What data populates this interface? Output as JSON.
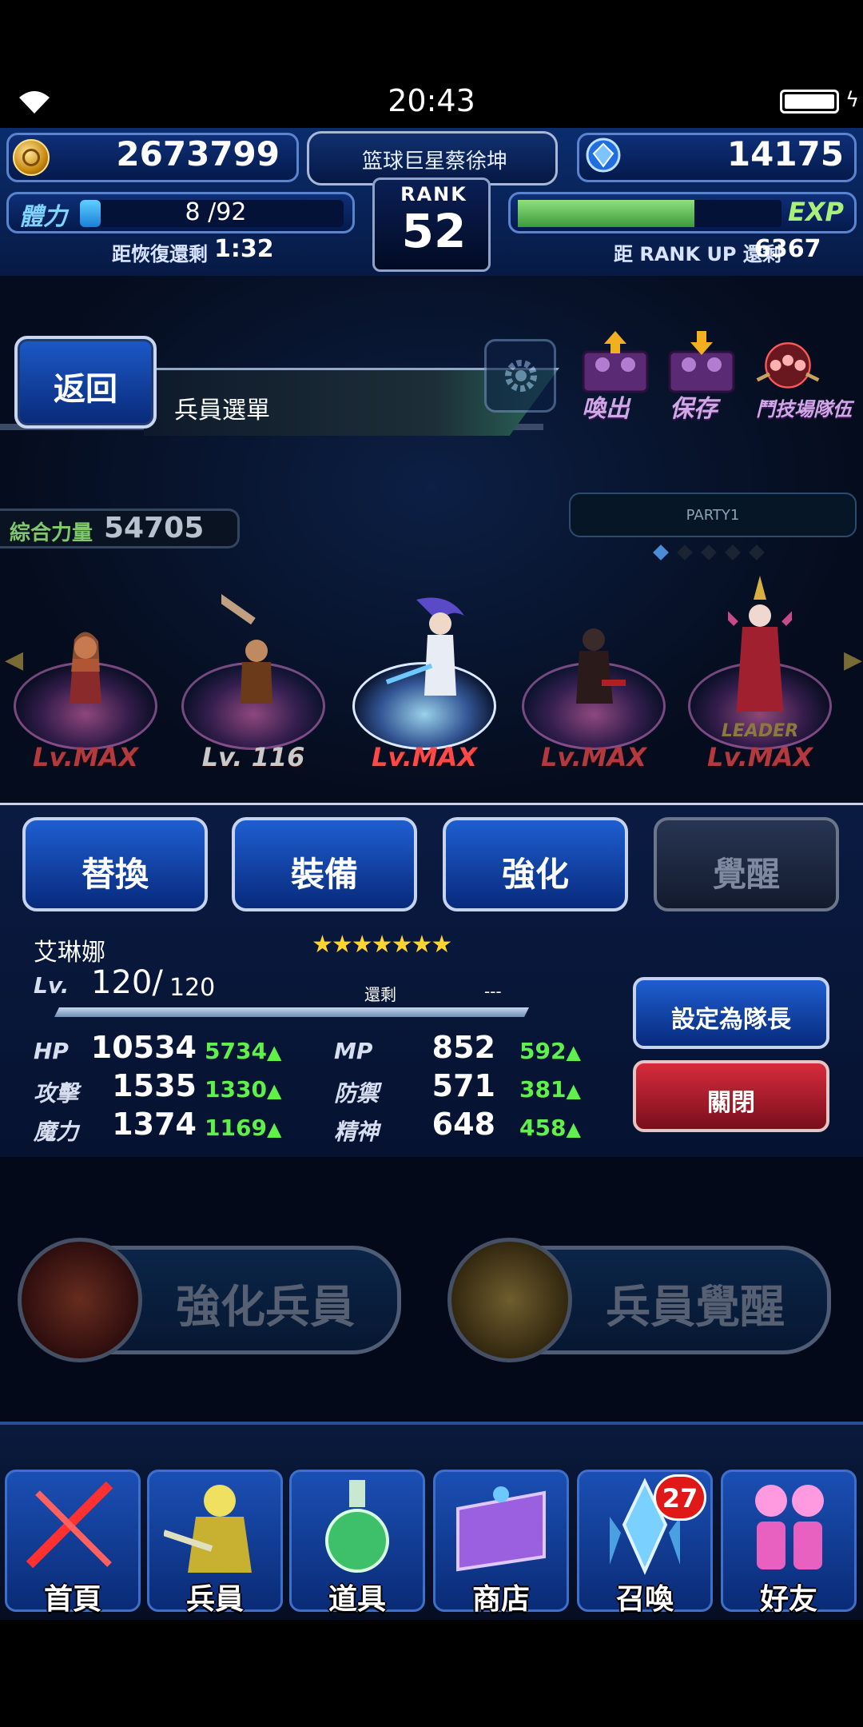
{
  "status_bar": {
    "time": "20:43"
  },
  "header": {
    "gil": "2673799",
    "player_name": "篮球巨星蔡徐坤",
    "gems": "14175",
    "stamina_label": "體力",
    "stamina_value": "8 /92",
    "stamina_fill_fraction": 0.08,
    "stamina_recover_label": "距恢復還剩",
    "stamina_recover_time": "1:32",
    "rank_label": "RANK",
    "rank_value": "52",
    "exp_label": "EXP",
    "exp_fill_fraction": 0.67,
    "rank_up_label": "距 RANK UP 還剩",
    "rank_up_value": "6367"
  },
  "toolbar": {
    "back_label": "返回",
    "title": "兵員選單",
    "call_label": "喚出",
    "save_label": "保存",
    "arena_label": "鬥技場隊伍"
  },
  "party": {
    "power_label": "綜合力量",
    "power_value": "54705",
    "tab_label": "PARTY1",
    "units": [
      {
        "level": "Lv.MAX"
      },
      {
        "level": "Lv. 116"
      },
      {
        "level": "Lv.MAX"
      },
      {
        "level": "Lv.MAX"
      },
      {
        "level": "Lv.MAX",
        "badge": "LEADER"
      }
    ]
  },
  "detail": {
    "tabs": [
      "替換",
      "裝備",
      "強化",
      "覺醒"
    ],
    "unit_name": "艾琳娜",
    "stars": "★★★★★★★",
    "lv_label": "Lv.",
    "lv_value": "120/",
    "lv_max": "120",
    "remain_label": "還剩",
    "remain_value": "---",
    "stats": {
      "hp_label": "HP",
      "hp_value": "10534",
      "hp_bonus": "5734",
      "mp_label": "MP",
      "mp_value": "852",
      "mp_bonus": "592",
      "atk_label": "攻擊",
      "atk_value": "1535",
      "atk_bonus": "1330",
      "def_label": "防禦",
      "def_value": "571",
      "def_bonus": "381",
      "mag_label": "魔力",
      "mag_value": "1374",
      "mag_bonus": "1169",
      "spr_label": "精神",
      "spr_value": "648",
      "spr_bonus": "458"
    },
    "set_leader_label": "設定為隊長",
    "close_label": "關閉"
  },
  "actions": {
    "enhance_label": "強化兵員",
    "awaken_label": "兵員覺醒"
  },
  "nav": {
    "home": "首頁",
    "units": "兵員",
    "items": "道具",
    "shop": "商店",
    "summon": "召喚",
    "summon_badge": "27",
    "friends": "好友"
  }
}
